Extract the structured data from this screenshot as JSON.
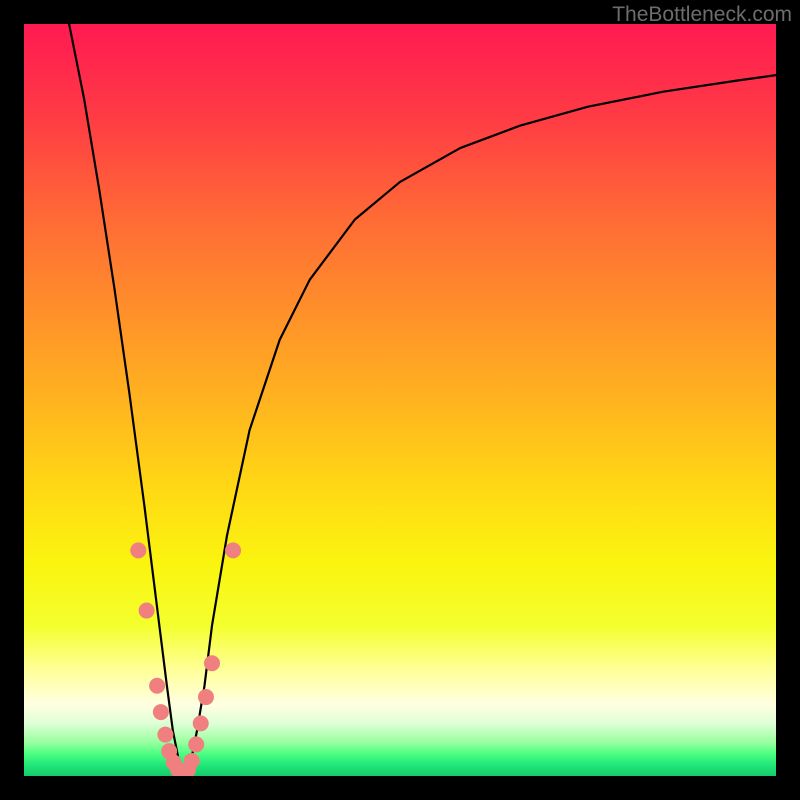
{
  "watermark": "TheBottleneck.com",
  "chart_data": {
    "type": "line",
    "title": "",
    "xlabel": "",
    "ylabel": "",
    "xlim": [
      0,
      100
    ],
    "ylim": [
      0,
      100
    ],
    "series": [
      {
        "name": "bottleneck-curve",
        "x": [
          6,
          8,
          10,
          12,
          14,
          16,
          17,
          18,
          19,
          19.8,
          20.6,
          21.4,
          22.2,
          23,
          24,
          25,
          27,
          30,
          34,
          38,
          44,
          50,
          58,
          66,
          75,
          85,
          95,
          100
        ],
        "y": [
          100,
          90,
          78,
          65,
          51,
          36,
          28,
          20,
          12,
          6,
          2,
          0.5,
          2,
          6,
          12,
          20,
          32,
          46,
          58,
          66,
          74,
          79,
          83.5,
          86.5,
          89,
          91,
          92.5,
          93.2
        ]
      }
    ],
    "markers": {
      "name": "pink-dots",
      "color": "#f08080",
      "points": [
        {
          "x": 15.2,
          "y": 30
        },
        {
          "x": 16.3,
          "y": 22
        },
        {
          "x": 17.7,
          "y": 12
        },
        {
          "x": 18.2,
          "y": 8.5
        },
        {
          "x": 18.8,
          "y": 5.5
        },
        {
          "x": 19.3,
          "y": 3.3
        },
        {
          "x": 19.9,
          "y": 1.8
        },
        {
          "x": 20.5,
          "y": 0.8
        },
        {
          "x": 21.1,
          "y": 0.3
        },
        {
          "x": 21.8,
          "y": 0.8
        },
        {
          "x": 22.3,
          "y": 2
        },
        {
          "x": 22.9,
          "y": 4.2
        },
        {
          "x": 23.5,
          "y": 7.0
        },
        {
          "x": 24.2,
          "y": 10.5
        },
        {
          "x": 25.0,
          "y": 15.0
        },
        {
          "x": 27.8,
          "y": 30
        }
      ]
    },
    "background_gradient": {
      "stops": [
        {
          "pos": 0,
          "color": "#ff1a52"
        },
        {
          "pos": 0.5,
          "color": "#ffb31f"
        },
        {
          "pos": 0.8,
          "color": "#f4ff2e"
        },
        {
          "pos": 0.93,
          "color": "#deffd5"
        },
        {
          "pos": 1.0,
          "color": "#17c96d"
        }
      ]
    }
  }
}
